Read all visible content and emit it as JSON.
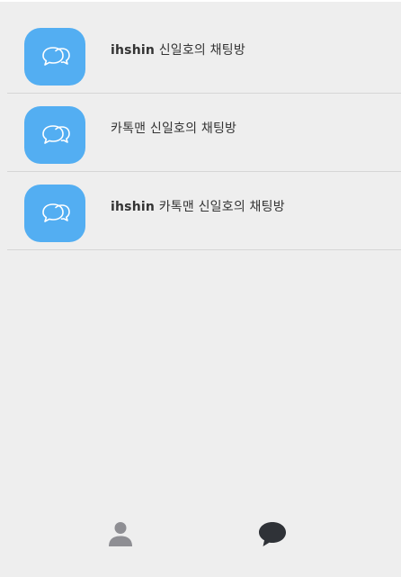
{
  "rooms": [
    {
      "user": "ihshin",
      "title": "신일호의 채팅방",
      "icon": "chat-bubbles-icon"
    },
    {
      "user": "",
      "title": "카톡맨 신일호의 채팅방",
      "icon": "chat-bubbles-icon"
    },
    {
      "user": "ihshin",
      "title": "카톡맨 신일호의 채팅방",
      "icon": "chat-bubbles-icon"
    }
  ],
  "nav": {
    "people_icon": "person-icon",
    "chat_icon": "speech-bubble-icon"
  },
  "colors": {
    "background": "#eeeeee",
    "avatar": "#53aef2",
    "divider": "#d6d6d6",
    "text": "#333333",
    "person_icon": "#8e8e93",
    "chat_icon": "#2f3237"
  }
}
